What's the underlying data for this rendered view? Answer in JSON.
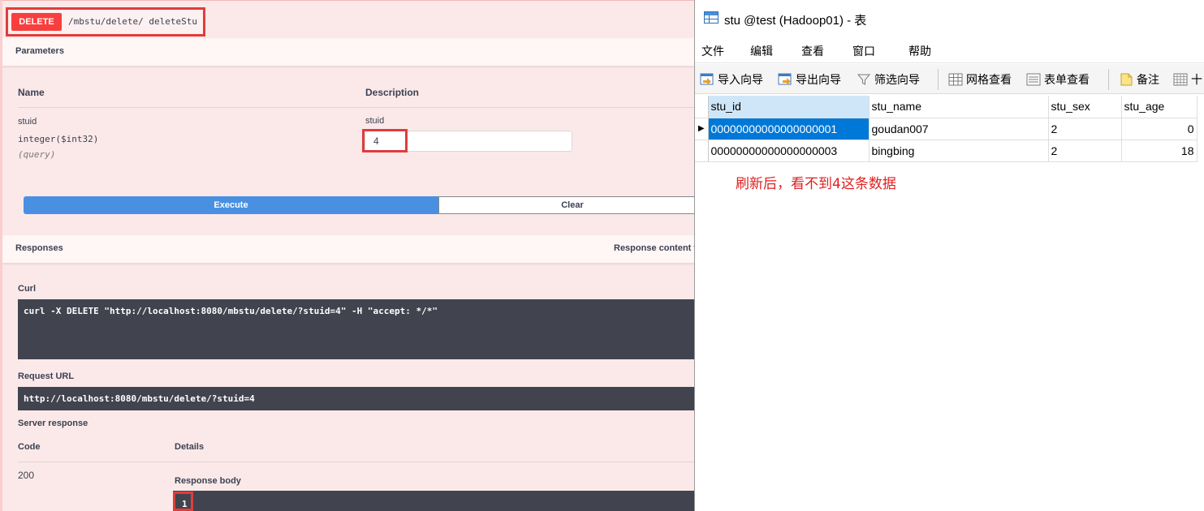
{
  "swagger": {
    "method": "DELETE",
    "path": "/mbstu/delete/  deleteStu",
    "parameters_label": "Parameters",
    "name_col": "Name",
    "description_col": "Description",
    "param_name": "stuid",
    "param_type": "integer($int32)",
    "param_in": "(query)",
    "param_desc": "stuid",
    "param_value": "4",
    "execute_label": "Execute",
    "clear_label": "Clear",
    "responses_label": "Responses",
    "response_content_type_label": "Response content t",
    "curl_label": "Curl",
    "curl_command": "curl -X DELETE \"http://localhost:8080/mbstu/delete/?stuid=4\" -H \"accept: */*\"",
    "request_url_label": "Request URL",
    "request_url": "http://localhost:8080/mbstu/delete/?stuid=4",
    "server_response_label": "Server response",
    "code_col": "Code",
    "details_col": "Details",
    "code_value": "200",
    "response_body_label": "Response body",
    "response_body_value": "1"
  },
  "navicat": {
    "title": "stu @test (Hadoop01) - 表",
    "menu": [
      "文件",
      "编辑",
      "查看",
      "窗口",
      "帮助"
    ],
    "toolbar": [
      "导入向导",
      "导出向导",
      "筛选向导",
      "网格查看",
      "表单查看",
      "备注",
      "十"
    ],
    "columns": [
      "stu_id",
      "stu_name",
      "stu_sex",
      "stu_age"
    ],
    "rows": [
      [
        "00000000000000000001",
        "goudan007",
        "2",
        "0"
      ],
      [
        "00000000000000000003",
        "bingbing",
        "2",
        "18"
      ]
    ],
    "annotation": "刷新后，看不到4这条数据"
  }
}
